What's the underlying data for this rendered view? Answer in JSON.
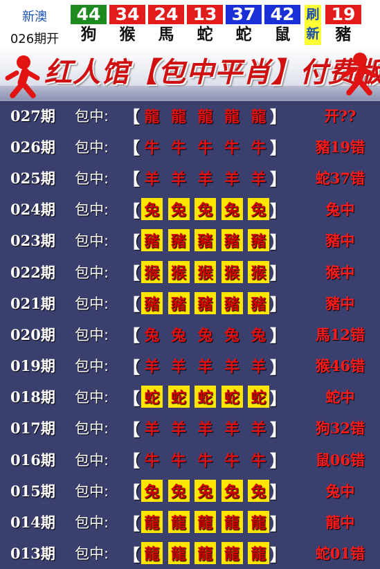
{
  "header": {
    "brand": "新澳",
    "issue": "026期开",
    "results": [
      {
        "num": "44",
        "zodiac": "狗",
        "color": "#1f8a1f"
      },
      {
        "num": "34",
        "zodiac": "猴",
        "color": "#e21b1b"
      },
      {
        "num": "24",
        "zodiac": "馬",
        "color": "#e21b1b"
      },
      {
        "num": "13",
        "zodiac": "蛇",
        "color": "#e21b1b"
      },
      {
        "num": "37",
        "zodiac": "蛇",
        "color": "#1a2fd6"
      },
      {
        "num": "42",
        "zodiac": "鼠",
        "color": "#1a2fd6"
      }
    ],
    "flash": {
      "line1": "刷",
      "line2": "新"
    },
    "special": {
      "num": "19",
      "zodiac": "豬",
      "color": "#e21b1b"
    }
  },
  "banner": {
    "title": "红人馆【包中平肖】付费版",
    "accent_color": "#d01010"
  },
  "rows": [
    {
      "period": "027期",
      "label": "包中:",
      "open": "【",
      "close": "】",
      "picks": [
        "龍",
        "龍",
        "龍",
        "龍",
        "龍"
      ],
      "highlight": false,
      "result": "开??"
    },
    {
      "period": "026期",
      "label": "包中:",
      "open": "【",
      "close": "】",
      "picks": [
        "牛",
        "牛",
        "牛",
        "牛",
        "牛"
      ],
      "highlight": false,
      "result": "豬19错"
    },
    {
      "period": "025期",
      "label": "包中:",
      "open": "【",
      "close": "】",
      "picks": [
        "羊",
        "羊",
        "羊",
        "羊",
        "羊"
      ],
      "highlight": false,
      "result": "蛇37错"
    },
    {
      "period": "024期",
      "label": "包中:",
      "open": "【",
      "close": "】",
      "picks": [
        "兔",
        "兔",
        "兔",
        "兔",
        "兔"
      ],
      "highlight": true,
      "result": "兔中"
    },
    {
      "period": "023期",
      "label": "包中:",
      "open": "【",
      "close": "】",
      "picks": [
        "豬",
        "豬",
        "豬",
        "豬",
        "豬"
      ],
      "highlight": true,
      "result": "豬中"
    },
    {
      "period": "022期",
      "label": "包中:",
      "open": "【",
      "close": "】",
      "picks": [
        "猴",
        "猴",
        "猴",
        "猴",
        "猴"
      ],
      "highlight": true,
      "result": "猴中"
    },
    {
      "period": "021期",
      "label": "包中:",
      "open": "【",
      "close": "】",
      "picks": [
        "豬",
        "豬",
        "豬",
        "豬",
        "豬"
      ],
      "highlight": true,
      "result": "豬中"
    },
    {
      "period": "020期",
      "label": "包中:",
      "open": "【",
      "close": "】",
      "picks": [
        "兔",
        "兔",
        "兔",
        "兔",
        "兔"
      ],
      "highlight": false,
      "result": "馬12错"
    },
    {
      "period": "019期",
      "label": "包中:",
      "open": "【",
      "close": "】",
      "picks": [
        "羊",
        "羊",
        "羊",
        "羊",
        "羊"
      ],
      "highlight": false,
      "result": "猴46错"
    },
    {
      "period": "018期",
      "label": "包中:",
      "open": "【",
      "close": "】",
      "picks": [
        "蛇",
        "蛇",
        "蛇",
        "蛇",
        "蛇"
      ],
      "highlight": true,
      "result": "蛇中"
    },
    {
      "period": "017期",
      "label": "包中:",
      "open": "【",
      "close": "】",
      "picks": [
        "羊",
        "羊",
        "羊",
        "羊",
        "羊"
      ],
      "highlight": false,
      "result": "狗32错"
    },
    {
      "period": "016期",
      "label": "包中:",
      "open": "【",
      "close": "】",
      "picks": [
        "牛",
        "牛",
        "牛",
        "牛",
        "牛"
      ],
      "highlight": false,
      "result": "鼠06错"
    },
    {
      "period": "015期",
      "label": "包中:",
      "open": "【",
      "close": "】",
      "picks": [
        "兔",
        "兔",
        "兔",
        "兔",
        "兔"
      ],
      "highlight": true,
      "result": "兔中"
    },
    {
      "period": "014期",
      "label": "包中:",
      "open": "【",
      "close": "】",
      "picks": [
        "龍",
        "龍",
        "龍",
        "龍",
        "龍"
      ],
      "highlight": true,
      "result": "龍中"
    },
    {
      "period": "013期",
      "label": "包中:",
      "open": "【",
      "close": "】",
      "picks": [
        "龍",
        "龍",
        "龍",
        "龍",
        "龍"
      ],
      "highlight": true,
      "result": "蛇01错"
    }
  ]
}
